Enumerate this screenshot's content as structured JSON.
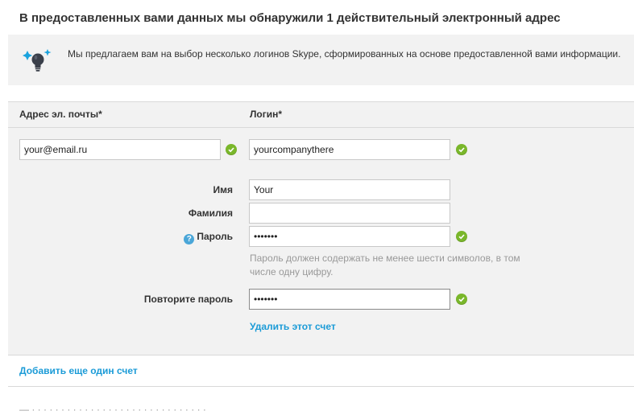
{
  "heading": "В предоставленных вами данных мы обнаружили 1 действительный электронный адрес",
  "info": {
    "icon": "lightbulb-icon",
    "text": "Мы предлагаем вам на выбор несколько логинов Skype, сформированных на основе предоставленной вами информации."
  },
  "form": {
    "email_label": "Адрес эл. почты*",
    "login_label": "Логин*",
    "email_value": "your@email.ru",
    "login_value": "yourcompanythere",
    "first_name_label": "Имя",
    "first_name_value": "Your",
    "last_name_label": "Фамилия",
    "last_name_value": "",
    "password_label": "Пароль",
    "password_help_icon": "?",
    "password_value": "•••••••",
    "password_hint": "Пароль должен содержать не менее шести символов, в том числе одну цифру.",
    "repeat_password_label": "Повторите пароль",
    "repeat_password_value": "•••••••",
    "delete_account_link": "Удалить этот счет"
  },
  "add_account_link": "Добавить еще один счет",
  "footer_partial": "—   ·  ·  ·  ·  ·  ·  ·  ·  ·  ·  ·  ·  ·  ·  ·  ·  ·  ·  ·  ·  ·  ·  ·  ·  ·  ·  ·  ·  ·  ·",
  "colors": {
    "accent": "#1b9bd7",
    "check": "#7ab72b",
    "panel_bg": "#f2f2f2"
  }
}
